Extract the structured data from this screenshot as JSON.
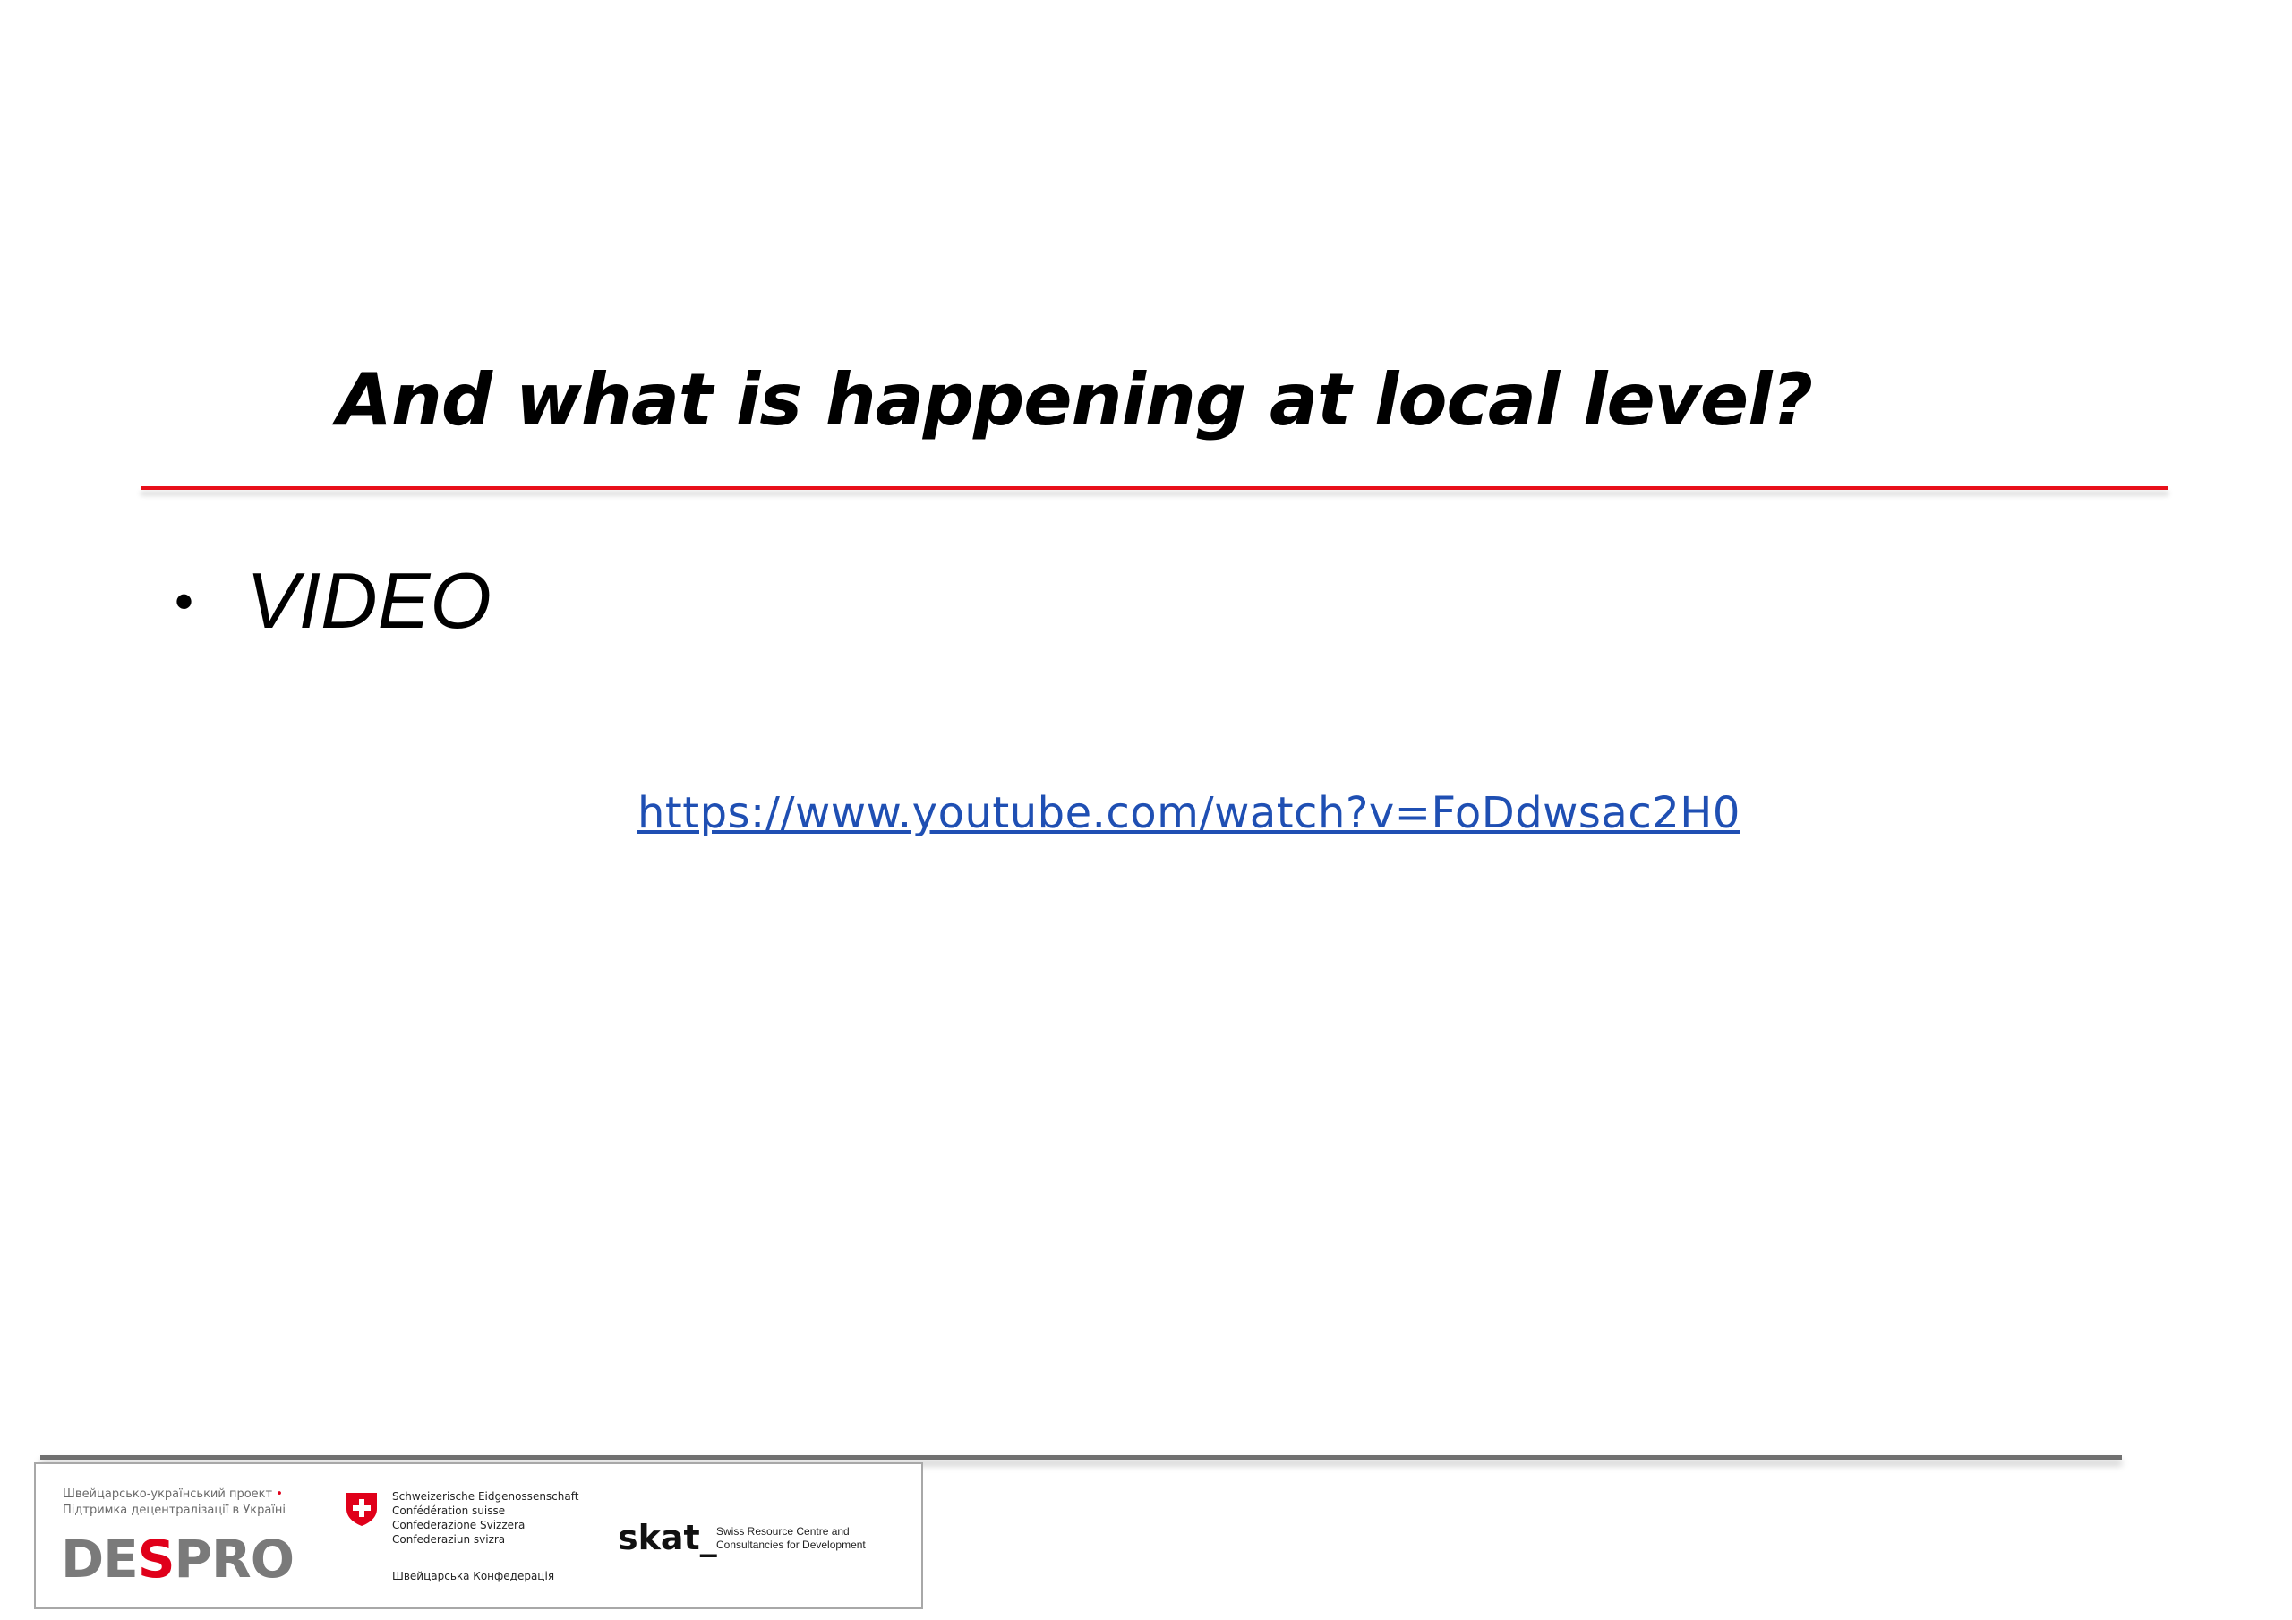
{
  "slide": {
    "title": "And what is happening at local level?",
    "bullets": [
      {
        "marker": "•",
        "text": "VIDEO"
      }
    ],
    "link": "https://www.youtube.com/watch?v=FoDdwsac2H0",
    "colors": {
      "title_rule": "#e8101a",
      "link": "#1f4fb3",
      "footer_rule": "#707070"
    }
  },
  "footer_logos": {
    "despro": {
      "line1": "Швейцарсько-український проект",
      "line1_mark": "•",
      "line2": "Підтримка децентралізації в Україні",
      "word_prefix": "DE",
      "word_s": "S",
      "word_suffix": "PRO"
    },
    "swiss": {
      "line1": "Schweizerische Eidgenossenschaft",
      "line2": "Confédération suisse",
      "line3": "Confederazione Svizzera",
      "line4": "Confederaziun svizra",
      "ua": "Швейцарська Конфедерація"
    },
    "skat": {
      "word": "skat_",
      "desc1": "Swiss Resource Centre and",
      "desc2": "Consultancies for Development"
    }
  }
}
